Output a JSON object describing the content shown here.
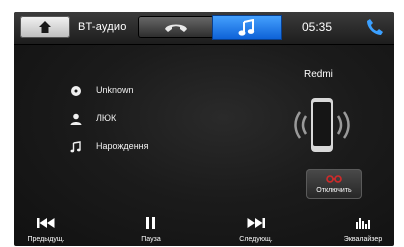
{
  "header": {
    "title": "BT-аудио",
    "clock": "05:35",
    "icons": {
      "home": "home-icon",
      "phone_tab": "phone-handset-icon",
      "music_tab": "music-note-icon",
      "call": "call-icon"
    }
  },
  "track_info": [
    {
      "icon": "disc-icon",
      "text": "Unknown"
    },
    {
      "icon": "person-icon",
      "text": "ЛЮК"
    },
    {
      "icon": "music-note-icon",
      "text": "Нарождення"
    }
  ],
  "device": {
    "name": "Redmi",
    "disconnect_label": "Отключить"
  },
  "controls": [
    {
      "icon": "previous-track-icon",
      "label": "Предыдущ."
    },
    {
      "icon": "pause-icon",
      "label": "Пауза"
    },
    {
      "icon": "next-track-icon",
      "label": "Следующ."
    },
    {
      "icon": "equalizer-icon",
      "label": "Эквалайзер"
    }
  ],
  "colors": {
    "accent": "#1e7ef0",
    "call_icon": "#3ba0ff",
    "disconnect_icon": "#d12a2a",
    "background": "#1b1b1b"
  }
}
